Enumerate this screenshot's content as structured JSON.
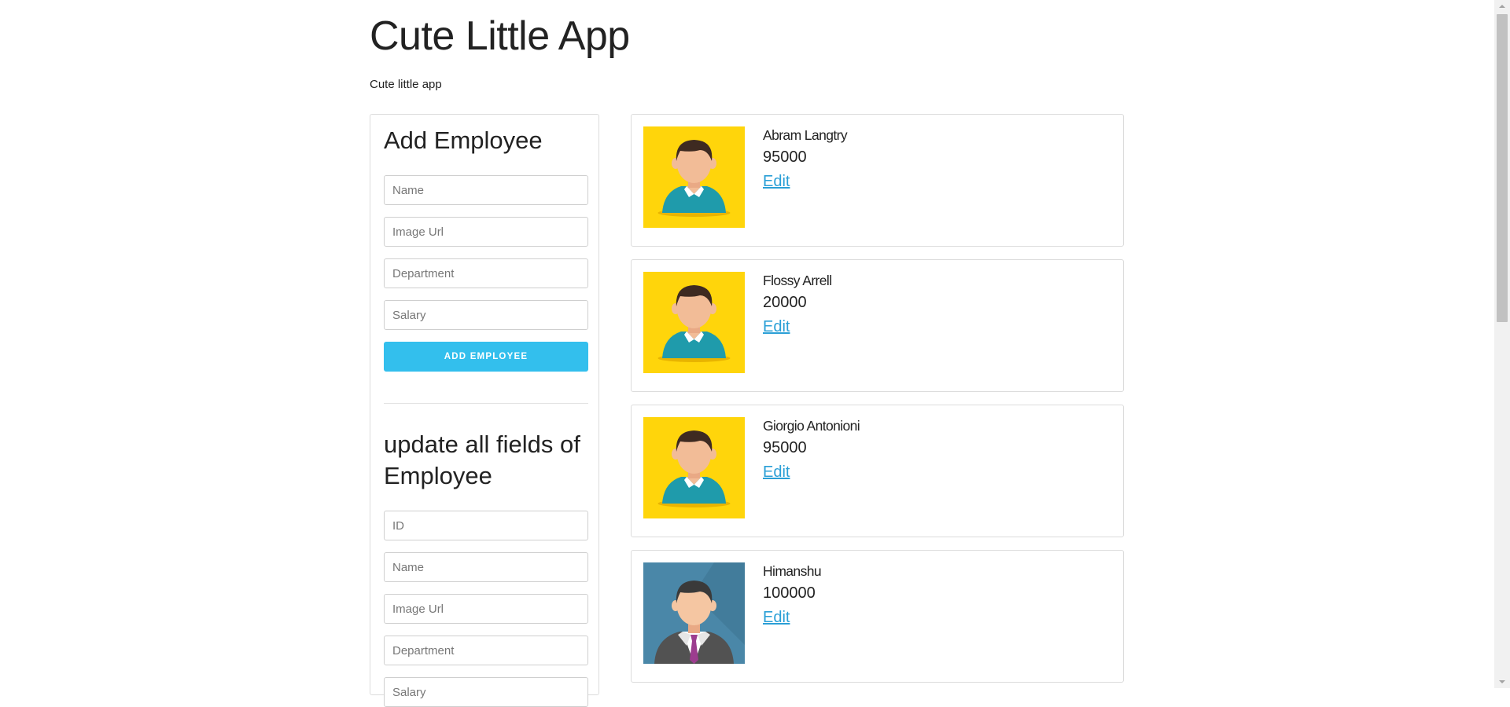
{
  "app": {
    "title": "Cute Little App",
    "subtitle": "Cute little app"
  },
  "add_form": {
    "heading": "Add Employee",
    "fields": [
      {
        "placeholder": "Name"
      },
      {
        "placeholder": "Image Url"
      },
      {
        "placeholder": "Department"
      },
      {
        "placeholder": "Salary"
      }
    ],
    "button_label": "ADD EMPLOYEE"
  },
  "update_form": {
    "heading": "update all fields of Employee",
    "fields": [
      {
        "placeholder": "ID"
      },
      {
        "placeholder": "Name"
      },
      {
        "placeholder": "Image Url"
      },
      {
        "placeholder": "Department"
      },
      {
        "placeholder": "Salary"
      }
    ]
  },
  "employees": [
    {
      "name": "Abram Langtry",
      "salary": "95000",
      "edit_label": "Edit",
      "avatar": "casual-person-avatar-icon"
    },
    {
      "name": "Flossy Arrell",
      "salary": "20000",
      "edit_label": "Edit",
      "avatar": "casual-person-avatar-icon"
    },
    {
      "name": "Giorgio Antonioni",
      "salary": "95000",
      "edit_label": "Edit",
      "avatar": "casual-person-avatar-icon"
    },
    {
      "name": "Himanshu",
      "salary": "100000",
      "edit_label": "Edit",
      "avatar": "businessman-avatar-icon"
    }
  ],
  "colors": {
    "accent": "#33bfed",
    "link": "#2a9fd6",
    "avatar_yellow": "#ffd50b",
    "avatar_blue": "#4a87a8"
  }
}
